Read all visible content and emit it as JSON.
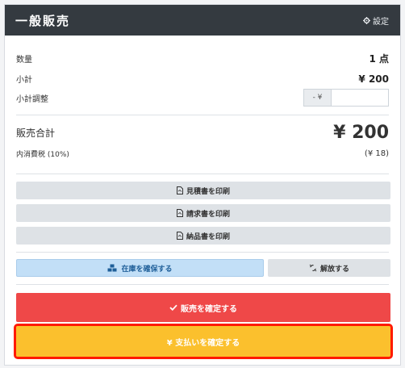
{
  "header": {
    "title": "一般販売",
    "settings_label": "設定"
  },
  "summary": {
    "quantity_label": "数量",
    "quantity_value": "1 点",
    "subtotal_label": "小計",
    "subtotal_value": "¥ 200",
    "adjustment_label": "小計調整",
    "adjustment_prefix": "- ¥",
    "adjustment_value": ""
  },
  "totals": {
    "total_label": "販売合計",
    "total_value": "¥ 200",
    "tax_label": "内消費税 (10%)",
    "tax_value": "(¥ 18)"
  },
  "print_buttons": {
    "estimate": "見積書を印刷",
    "invoice": "請求書を印刷",
    "delivery": "納品書を印刷"
  },
  "stock": {
    "reserve_label": "在庫を確保する",
    "release_label": "解放する"
  },
  "actions": {
    "confirm_sale": "販売を確定する",
    "confirm_payment": "¥ 支払いを確定する"
  },
  "colors": {
    "header": "#343a40",
    "danger": "#ef4848",
    "warning": "#fbc02d",
    "highlight_outline": "#ff1a00"
  }
}
